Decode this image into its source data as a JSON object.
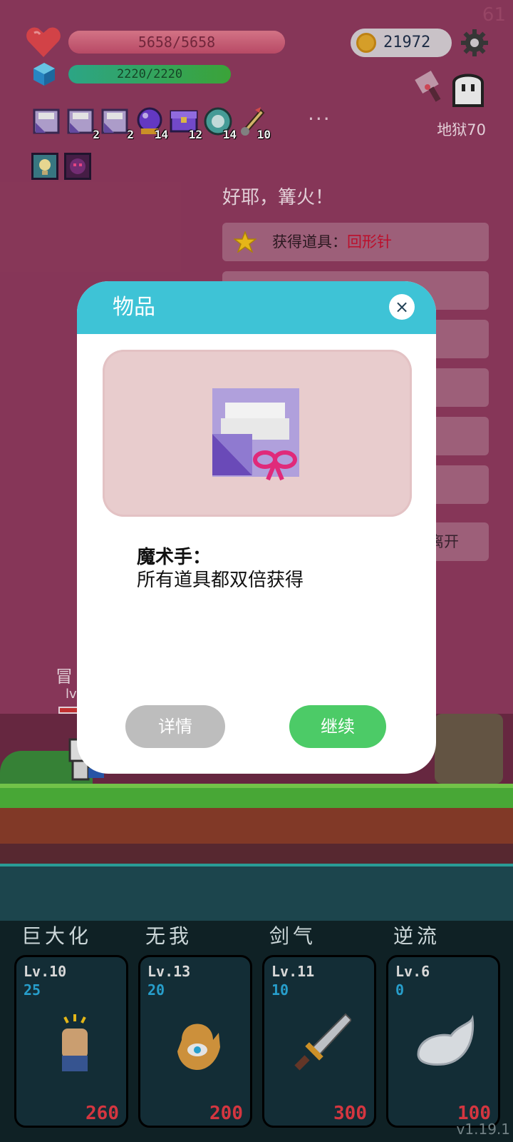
{
  "fps": "61",
  "hud": {
    "hp_text": "5658/5658",
    "hp_ratio": 1.0,
    "mp_text": "2220/2220",
    "mp_ratio": 1.0,
    "coins": "21972",
    "difficulty": "地狱70",
    "more": "···"
  },
  "inventory": [
    {
      "icon": "scroll-ribbon-icon",
      "count": ""
    },
    {
      "icon": "scroll-ribbon-icon",
      "count": "2"
    },
    {
      "icon": "scroll-icon",
      "count": "2"
    },
    {
      "icon": "purple-orb-icon",
      "count": "14"
    },
    {
      "icon": "purple-chest-icon",
      "count": "12"
    },
    {
      "icon": "teal-ring-icon",
      "count": "14"
    },
    {
      "icon": "rocket-icon",
      "count": "10"
    }
  ],
  "event": {
    "title": "好耶，篝火！",
    "item_prefix": "获得道具：",
    "item_name": "回形针",
    "leave_label": "离开"
  },
  "hero": {
    "name": "冒",
    "level": "lv"
  },
  "skills": [
    {
      "name": "巨大化",
      "level": "Lv.10",
      "value": "25",
      "cost": "260",
      "icon": "fist-icon"
    },
    {
      "name": "无我",
      "level": "Lv.13",
      "value": "20",
      "cost": "200",
      "icon": "eye-hand-icon"
    },
    {
      "name": "剑气",
      "level": "Lv.11",
      "value": "10",
      "cost": "300",
      "icon": "sword-icon"
    },
    {
      "name": "逆流",
      "level": "Lv.6",
      "value": "0",
      "cost": "100",
      "icon": "wing-icon"
    }
  ],
  "version": "v1.19.1",
  "modal": {
    "title": "物品",
    "close": "×",
    "item_name": "魔术手：",
    "item_desc": "所有道具都双倍获得",
    "detail_button": "详情",
    "continue_button": "继续"
  },
  "colors": {
    "background": "#8f3a5e",
    "modal_header": "#3ec3d6",
    "continue_button": "#4ccb67",
    "detail_button": "#bdbdbd",
    "highlight": "#c8102e"
  }
}
